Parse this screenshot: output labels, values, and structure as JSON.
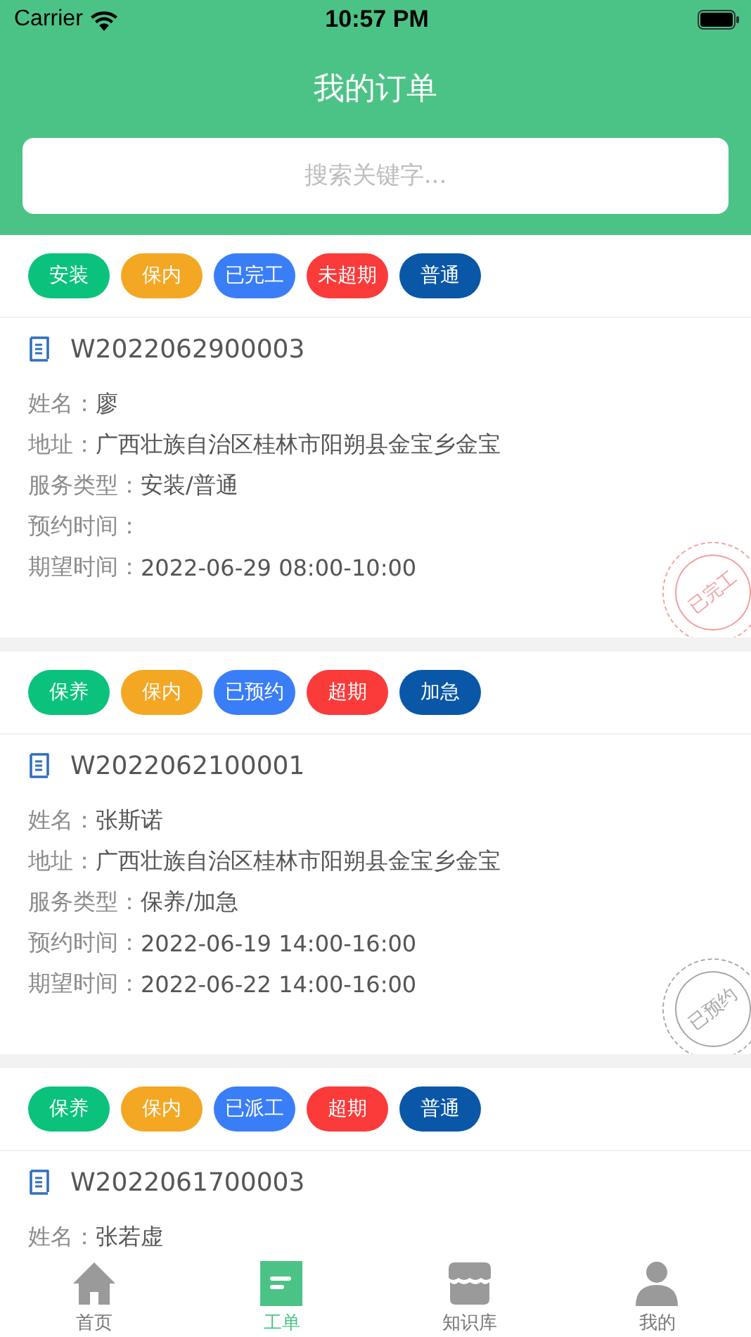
{
  "status_bar": {
    "carrier": "Carrier",
    "time": "10:57 PM"
  },
  "header": {
    "title": "我的订单",
    "search": {
      "placeholder": "搜索关键字..."
    }
  },
  "orders": [
    {
      "tags": [
        {
          "label": "安装",
          "color": "#0bc27c"
        },
        {
          "label": "保内",
          "color": "#f4a723"
        },
        {
          "label": "已完工",
          "color": "#3a7ef7"
        },
        {
          "label": "未超期",
          "color": "#fb3a3a"
        },
        {
          "label": "普通",
          "color": "#0a57a8"
        }
      ],
      "number": "W2022062900003",
      "rows": [
        {
          "label": "姓名：",
          "value": "廖"
        },
        {
          "label": "地址：",
          "value": "广西壮族自治区桂林市阳朔县金宝乡金宝"
        },
        {
          "label": "服务类型：",
          "value": "安装/普通"
        },
        {
          "label": "预约时间："
        },
        {
          "label": "期望时间：",
          "value": "2022-06-29 08:00-10:00"
        }
      ],
      "stamp": {
        "text": "已完工",
        "color": "#f4a0a0"
      }
    },
    {
      "tags": [
        {
          "label": "保养",
          "color": "#0bc27c"
        },
        {
          "label": "保内",
          "color": "#f4a723"
        },
        {
          "label": "已预约",
          "color": "#3a7ef7"
        },
        {
          "label": "超期",
          "color": "#fb3a3a"
        },
        {
          "label": "加急",
          "color": "#0a57a8"
        }
      ],
      "number": "W2022062100001",
      "rows": [
        {
          "label": "姓名：",
          "value": "张斯诺"
        },
        {
          "label": "地址：",
          "value": "广西壮族自治区桂林市阳朔县金宝乡金宝"
        },
        {
          "label": "服务类型：",
          "value": "保养/加急"
        },
        {
          "label": "预约时间：",
          "value": "2022-06-19 14:00-16:00"
        },
        {
          "label": "期望时间：",
          "value": "2022-06-22 14:00-16:00"
        }
      ],
      "stamp": {
        "text": "已预约",
        "color": "#a8a8a8"
      }
    },
    {
      "tags": [
        {
          "label": "保养",
          "color": "#0bc27c"
        },
        {
          "label": "保内",
          "color": "#f4a723"
        },
        {
          "label": "已派工",
          "color": "#3a7ef7"
        },
        {
          "label": "超期",
          "color": "#fb3a3a"
        },
        {
          "label": "普通",
          "color": "#0a57a8"
        }
      ],
      "number": "W2022061700003",
      "rows": [
        {
          "label": "姓名：",
          "value": "张若虚"
        }
      ]
    }
  ],
  "tab_bar": [
    {
      "kind": "home",
      "label": "首页",
      "selected": false
    },
    {
      "kind": "orders",
      "label": "工单",
      "selected": true
    },
    {
      "kind": "store",
      "label": "知识库",
      "selected": false
    },
    {
      "kind": "profile",
      "label": "我的",
      "selected": false
    }
  ]
}
